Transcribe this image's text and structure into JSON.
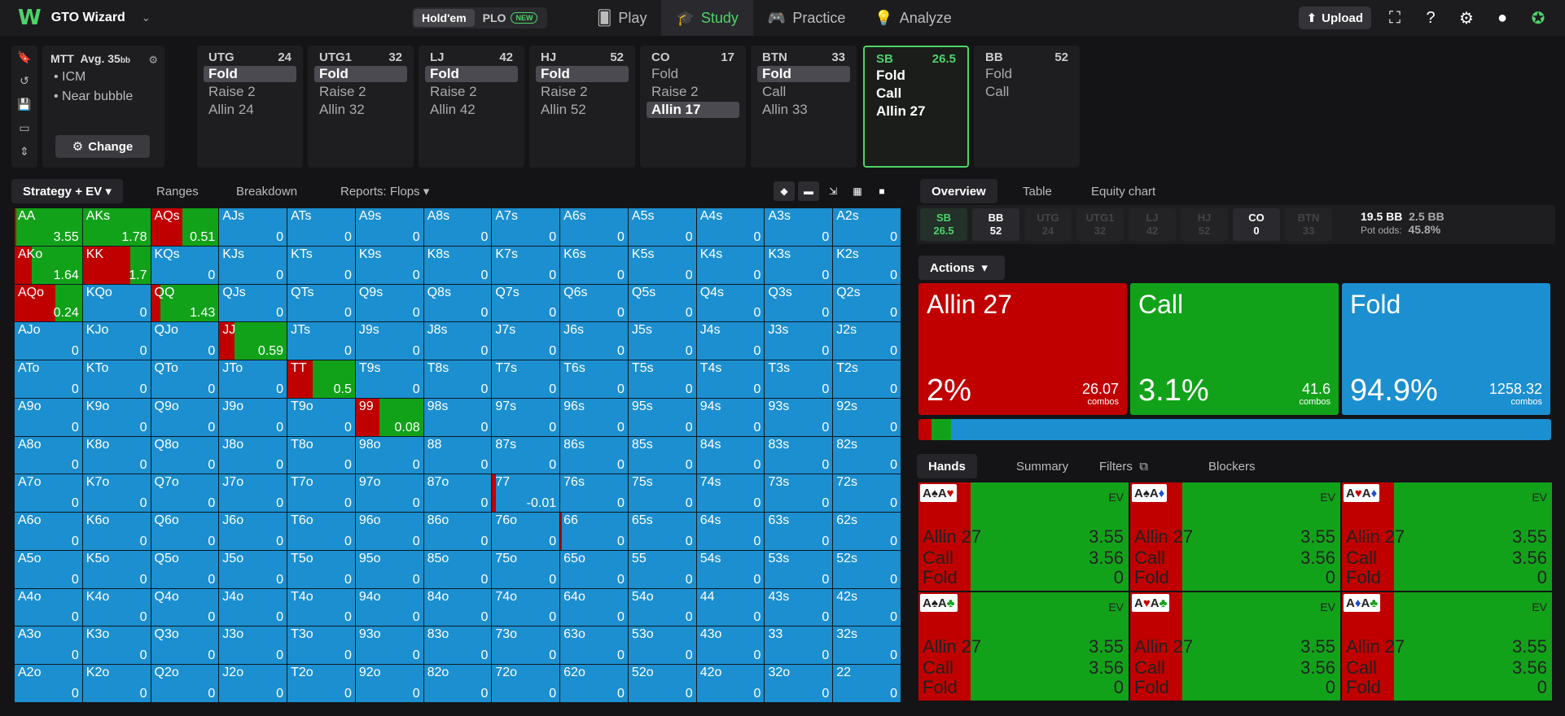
{
  "app": {
    "name": "GTO Wizard"
  },
  "game_toggle": {
    "holdem": "Hold'em",
    "plo": "PLO",
    "plo_badge": "NEW"
  },
  "nav": {
    "play": "Play",
    "study": "Study",
    "practice": "Practice",
    "analyze": "Analyze"
  },
  "topbar": {
    "upload": "Upload"
  },
  "mtt": {
    "title": "MTT",
    "avg": "Avg. 35",
    "avg_unit": "bb",
    "items": [
      "ICM",
      "Near bubble"
    ],
    "change": "Change"
  },
  "seats": [
    {
      "pos": "UTG",
      "stack": "24",
      "actions": [
        "Fold",
        "Raise 2",
        "Allin 24"
      ],
      "selected": 0
    },
    {
      "pos": "UTG1",
      "stack": "32",
      "actions": [
        "Fold",
        "Raise 2",
        "Allin 32"
      ],
      "selected": 0
    },
    {
      "pos": "LJ",
      "stack": "42",
      "actions": [
        "Fold",
        "Raise 2",
        "Allin 42"
      ],
      "selected": 0
    },
    {
      "pos": "HJ",
      "stack": "52",
      "actions": [
        "Fold",
        "Raise 2",
        "Allin 52"
      ],
      "selected": 0
    },
    {
      "pos": "CO",
      "stack": "17",
      "actions": [
        "Fold",
        "Raise 2",
        "Allin 17"
      ],
      "selected": 2
    },
    {
      "pos": "BTN",
      "stack": "33",
      "actions": [
        "Fold",
        "Call",
        "Allin 33"
      ],
      "selected": 0
    },
    {
      "pos": "SB",
      "stack": "26.5",
      "actions": [
        "Fold",
        "Call",
        "Allin 27"
      ],
      "selected": -1,
      "active": true
    },
    {
      "pos": "BB",
      "stack": "52",
      "actions": [
        "Fold",
        "Call"
      ],
      "selected": -1
    }
  ],
  "left_tabs": {
    "strategy": "Strategy + EV",
    "ranges": "Ranges",
    "breakdown": "Breakdown",
    "reports": "Reports: Flops"
  },
  "colors": {
    "allin": "#c00000",
    "call": "#12a21a",
    "fold": "#1b8fd0"
  },
  "matrix": [
    [
      [
        "AA",
        "3.55",
        [
          2,
          0
        ]
      ],
      [
        "AKs",
        "1.78",
        [
          0,
          0
        ]
      ],
      [
        "AQs",
        "0.51",
        [
          46,
          0
        ]
      ],
      [
        "AJs",
        "0"
      ],
      [
        "ATs",
        "0"
      ],
      [
        "A9s",
        "0"
      ],
      [
        "A8s",
        "0"
      ],
      [
        "A7s",
        "0"
      ],
      [
        "A6s",
        "0"
      ],
      [
        "A5s",
        "0"
      ],
      [
        "A4s",
        "0"
      ],
      [
        "A3s",
        "0"
      ],
      [
        "A2s",
        "0"
      ]
    ],
    [
      [
        "AKo",
        "1.64",
        [
          25,
          0
        ]
      ],
      [
        "KK",
        "1.7",
        [
          70,
          0
        ]
      ],
      [
        "KQs",
        "0"
      ],
      [
        "KJs",
        "0"
      ],
      [
        "KTs",
        "0"
      ],
      [
        "K9s",
        "0"
      ],
      [
        "K8s",
        "0"
      ],
      [
        "K7s",
        "0"
      ],
      [
        "K6s",
        "0"
      ],
      [
        "K5s",
        "0"
      ],
      [
        "K4s",
        "0"
      ],
      [
        "K3s",
        "0"
      ],
      [
        "K2s",
        "0"
      ]
    ],
    [
      [
        "AQo",
        "0.24",
        [
          60,
          0
        ]
      ],
      [
        "KQo",
        "0"
      ],
      [
        "QQ",
        "1.43",
        [
          14,
          0
        ]
      ],
      [
        "QJs",
        "0"
      ],
      [
        "QTs",
        "0"
      ],
      [
        "Q9s",
        "0"
      ],
      [
        "Q8s",
        "0"
      ],
      [
        "Q7s",
        "0"
      ],
      [
        "Q6s",
        "0"
      ],
      [
        "Q5s",
        "0"
      ],
      [
        "Q4s",
        "0"
      ],
      [
        "Q3s",
        "0"
      ],
      [
        "Q2s",
        "0"
      ]
    ],
    [
      [
        "AJo",
        "0"
      ],
      [
        "KJo",
        "0"
      ],
      [
        "QJo",
        "0"
      ],
      [
        "JJ",
        "0.59",
        [
          22,
          0
        ]
      ],
      [
        "JTs",
        "0"
      ],
      [
        "J9s",
        "0"
      ],
      [
        "J8s",
        "0"
      ],
      [
        "J7s",
        "0"
      ],
      [
        "J6s",
        "0"
      ],
      [
        "J5s",
        "0"
      ],
      [
        "J4s",
        "0"
      ],
      [
        "J3s",
        "0"
      ],
      [
        "J2s",
        "0"
      ]
    ],
    [
      [
        "ATo",
        "0"
      ],
      [
        "KTo",
        "0"
      ],
      [
        "QTo",
        "0"
      ],
      [
        "JTo",
        "0"
      ],
      [
        "TT",
        "0.5",
        [
          37,
          0
        ]
      ],
      [
        "T9s",
        "0"
      ],
      [
        "T8s",
        "0"
      ],
      [
        "T7s",
        "0"
      ],
      [
        "T6s",
        "0"
      ],
      [
        "T5s",
        "0"
      ],
      [
        "T4s",
        "0"
      ],
      [
        "T3s",
        "0"
      ],
      [
        "T2s",
        "0"
      ]
    ],
    [
      [
        "A9o",
        "0"
      ],
      [
        "K9o",
        "0"
      ],
      [
        "Q9o",
        "0"
      ],
      [
        "J9o",
        "0"
      ],
      [
        "T9o",
        "0"
      ],
      [
        "99",
        "0.08",
        [
          35,
          0
        ]
      ],
      [
        "98s",
        "0"
      ],
      [
        "97s",
        "0"
      ],
      [
        "96s",
        "0"
      ],
      [
        "95s",
        "0"
      ],
      [
        "94s",
        "0"
      ],
      [
        "93s",
        "0"
      ],
      [
        "92s",
        "0"
      ]
    ],
    [
      [
        "A8o",
        "0"
      ],
      [
        "K8o",
        "0"
      ],
      [
        "Q8o",
        "0"
      ],
      [
        "J8o",
        "0"
      ],
      [
        "T8o",
        "0"
      ],
      [
        "98o",
        "0"
      ],
      [
        "88",
        "0"
      ],
      [
        "87s",
        "0"
      ],
      [
        "86s",
        "0"
      ],
      [
        "85s",
        "0"
      ],
      [
        "84s",
        "0"
      ],
      [
        "83s",
        "0"
      ],
      [
        "82s",
        "0"
      ]
    ],
    [
      [
        "A7o",
        "0"
      ],
      [
        "K7o",
        "0"
      ],
      [
        "Q7o",
        "0"
      ],
      [
        "J7o",
        "0"
      ],
      [
        "T7o",
        "0"
      ],
      [
        "97o",
        "0"
      ],
      [
        "87o",
        "0"
      ],
      [
        "77",
        "-0.01",
        [
          6,
          0
        ]
      ],
      [
        "76s",
        "0"
      ],
      [
        "75s",
        "0"
      ],
      [
        "74s",
        "0"
      ],
      [
        "73s",
        "0"
      ],
      [
        "72s",
        "0"
      ]
    ],
    [
      [
        "A6o",
        "0"
      ],
      [
        "K6o",
        "0"
      ],
      [
        "Q6o",
        "0"
      ],
      [
        "J6o",
        "0"
      ],
      [
        "T6o",
        "0"
      ],
      [
        "96o",
        "0"
      ],
      [
        "86o",
        "0"
      ],
      [
        "76o",
        "0"
      ],
      [
        "66",
        "0",
        [
          2,
          0
        ]
      ],
      [
        "65s",
        "0"
      ],
      [
        "64s",
        "0"
      ],
      [
        "63s",
        "0"
      ],
      [
        "62s",
        "0"
      ]
    ],
    [
      [
        "A5o",
        "0"
      ],
      [
        "K5o",
        "0"
      ],
      [
        "Q5o",
        "0"
      ],
      [
        "J5o",
        "0"
      ],
      [
        "T5o",
        "0"
      ],
      [
        "95o",
        "0"
      ],
      [
        "85o",
        "0"
      ],
      [
        "75o",
        "0"
      ],
      [
        "65o",
        "0"
      ],
      [
        "55",
        "0"
      ],
      [
        "54s",
        "0"
      ],
      [
        "53s",
        "0"
      ],
      [
        "52s",
        "0"
      ]
    ],
    [
      [
        "A4o",
        "0"
      ],
      [
        "K4o",
        "0"
      ],
      [
        "Q4o",
        "0"
      ],
      [
        "J4o",
        "0"
      ],
      [
        "T4o",
        "0"
      ],
      [
        "94o",
        "0"
      ],
      [
        "84o",
        "0"
      ],
      [
        "74o",
        "0"
      ],
      [
        "64o",
        "0"
      ],
      [
        "54o",
        "0"
      ],
      [
        "44",
        "0"
      ],
      [
        "43s",
        "0"
      ],
      [
        "42s",
        "0"
      ]
    ],
    [
      [
        "A3o",
        "0"
      ],
      [
        "K3o",
        "0"
      ],
      [
        "Q3o",
        "0"
      ],
      [
        "J3o",
        "0"
      ],
      [
        "T3o",
        "0"
      ],
      [
        "93o",
        "0"
      ],
      [
        "83o",
        "0"
      ],
      [
        "73o",
        "0"
      ],
      [
        "63o",
        "0"
      ],
      [
        "53o",
        "0"
      ],
      [
        "43o",
        "0"
      ],
      [
        "33",
        "0"
      ],
      [
        "32s",
        "0"
      ]
    ],
    [
      [
        "A2o",
        "0"
      ],
      [
        "K2o",
        "0"
      ],
      [
        "Q2o",
        "0"
      ],
      [
        "J2o",
        "0"
      ],
      [
        "T2o",
        "0"
      ],
      [
        "92o",
        "0"
      ],
      [
        "82o",
        "0"
      ],
      [
        "72o",
        "0"
      ],
      [
        "62o",
        "0"
      ],
      [
        "52o",
        "0"
      ],
      [
        "42o",
        "0"
      ],
      [
        "32o",
        "0"
      ],
      [
        "22",
        "0"
      ]
    ]
  ],
  "right_tabs": {
    "overview": "Overview",
    "table": "Table",
    "equity": "Equity chart"
  },
  "positions": [
    {
      "pos": "SB",
      "val": "26.5",
      "state": "active"
    },
    {
      "pos": "BB",
      "val": "52",
      "state": "norm"
    },
    {
      "pos": "UTG",
      "val": "24",
      "state": "dim"
    },
    {
      "pos": "UTG1",
      "val": "32",
      "state": "dim"
    },
    {
      "pos": "LJ",
      "val": "42",
      "state": "dim"
    },
    {
      "pos": "HJ",
      "val": "52",
      "state": "dim"
    },
    {
      "pos": "CO",
      "val": "0",
      "state": "norm"
    },
    {
      "pos": "BTN",
      "val": "33",
      "state": "dim"
    }
  ],
  "pot": {
    "bb": "19.5 BB",
    "bb2": "2.5 BB",
    "odds_label": "Pot odds:",
    "odds": "45.8%"
  },
  "actions_label": "Actions",
  "action_boxes": [
    {
      "name": "Allin 27",
      "pct": "2%",
      "combos": "26.07",
      "combos_label": "combos",
      "freq": 2.0
    },
    {
      "name": "Call",
      "pct": "3.1%",
      "combos": "41.6",
      "combos_label": "combos",
      "freq": 3.1
    },
    {
      "name": "Fold",
      "pct": "94.9%",
      "combos": "1258.32",
      "combos_label": "combos",
      "freq": 94.9
    }
  ],
  "hand_tabs": {
    "hands": "Hands",
    "summary": "Summary",
    "filters": "Filters",
    "blockers": "Blockers"
  },
  "hand_cards": [
    {
      "cards": [
        [
          "A",
          "♠",
          "#222"
        ],
        [
          "A",
          "♥",
          "#c00"
        ]
      ],
      "ev_label": "EV",
      "rows": [
        [
          "Allin 27",
          "3.55"
        ],
        [
          "Call",
          "3.56"
        ],
        [
          "Fold",
          "0"
        ]
      ]
    },
    {
      "cards": [
        [
          "A",
          "♠",
          "#222"
        ],
        [
          "A",
          "♦",
          "#1a4fd6"
        ]
      ],
      "ev_label": "EV",
      "rows": [
        [
          "Allin 27",
          "3.55"
        ],
        [
          "Call",
          "3.56"
        ],
        [
          "Fold",
          "0"
        ]
      ]
    },
    {
      "cards": [
        [
          "A",
          "♥",
          "#c00"
        ],
        [
          "A",
          "♦",
          "#1a4fd6"
        ]
      ],
      "ev_label": "EV",
      "rows": [
        [
          "Allin 27",
          "3.55"
        ],
        [
          "Call",
          "3.56"
        ],
        [
          "Fold",
          "0"
        ]
      ]
    },
    {
      "cards": [
        [
          "A",
          "♠",
          "#222"
        ],
        [
          "A",
          "♣",
          "#12a21a"
        ]
      ],
      "ev_label": "EV",
      "rows": [
        [
          "Allin 27",
          "3.55"
        ],
        [
          "Call",
          "3.56"
        ],
        [
          "Fold",
          "0"
        ]
      ]
    },
    {
      "cards": [
        [
          "A",
          "♥",
          "#c00"
        ],
        [
          "A",
          "♣",
          "#12a21a"
        ]
      ],
      "ev_label": "EV",
      "rows": [
        [
          "Allin 27",
          "3.55"
        ],
        [
          "Call",
          "3.56"
        ],
        [
          "Fold",
          "0"
        ]
      ]
    },
    {
      "cards": [
        [
          "A",
          "♦",
          "#1a4fd6"
        ],
        [
          "A",
          "♣",
          "#12a21a"
        ]
      ],
      "ev_label": "EV",
      "rows": [
        [
          "Allin 27",
          "3.55"
        ],
        [
          "Call",
          "3.56"
        ],
        [
          "Fold",
          "0"
        ]
      ]
    }
  ]
}
